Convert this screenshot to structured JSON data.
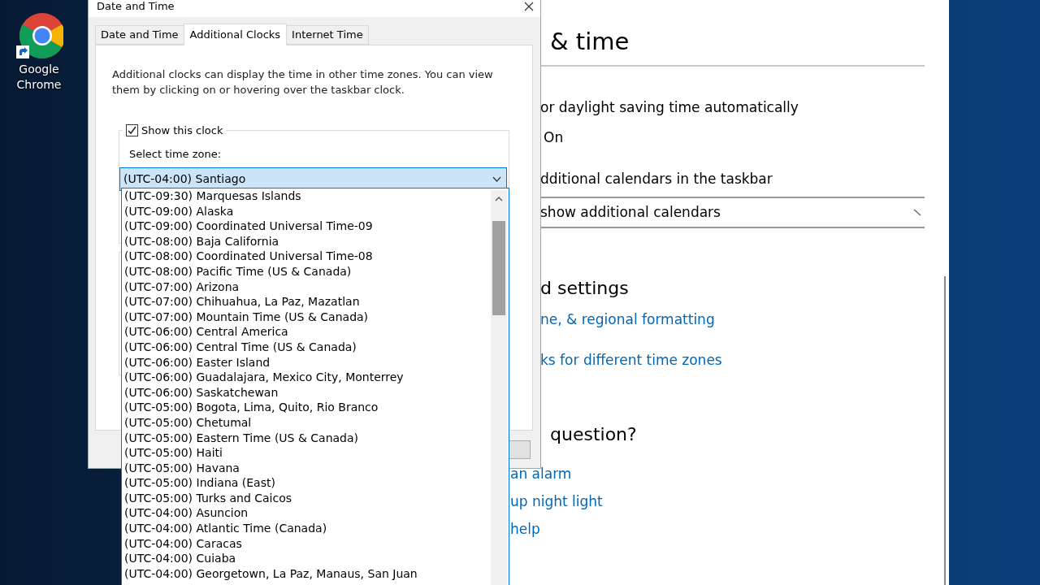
{
  "desktop": {
    "icons": [
      {
        "label": "Google Chrome"
      }
    ]
  },
  "settings": {
    "heading": "& time",
    "rows": [
      {
        "kind": "label",
        "text": "or daylight saving time automatically"
      },
      {
        "kind": "value",
        "text": "On"
      },
      {
        "kind": "label",
        "text": "dditional calendars in the taskbar"
      },
      {
        "kind": "select",
        "text": "show additional calendars"
      },
      {
        "kind": "heading",
        "text": "d settings"
      },
      {
        "kind": "link",
        "text": "ne, & regional formatting"
      },
      {
        "kind": "link",
        "text": "ks for different time zones"
      },
      {
        "kind": "heading",
        "text": "question?"
      },
      {
        "kind": "link",
        "text": "an alarm"
      },
      {
        "kind": "link",
        "text": "up night light"
      },
      {
        "kind": "link",
        "text": "help"
      }
    ]
  },
  "dialog": {
    "title": "Date and Time",
    "tabs": [
      {
        "label": "Date and Time",
        "selected": false
      },
      {
        "label": "Additional Clocks",
        "selected": true
      },
      {
        "label": "Internet Time",
        "selected": false
      }
    ],
    "description": "Additional clocks can display the time in other time zones. You can view them by clicking on or hovering over the taskbar clock.",
    "show_clock": {
      "label": "Show this clock",
      "checked": true
    },
    "time_zone": {
      "label": "Select time zone:",
      "value": "(UTC-04:00) Santiago",
      "options": [
        {
          "label": "(UTC-09:30) Marquesas Islands",
          "selected": false
        },
        {
          "label": "(UTC-09:00) Alaska",
          "selected": false
        },
        {
          "label": "(UTC-09:00) Coordinated Universal Time-09",
          "selected": false
        },
        {
          "label": "(UTC-08:00) Baja California",
          "selected": false
        },
        {
          "label": "(UTC-08:00) Coordinated Universal Time-08",
          "selected": false
        },
        {
          "label": "(UTC-08:00) Pacific Time (US & Canada)",
          "selected": false
        },
        {
          "label": "(UTC-07:00) Arizona",
          "selected": false
        },
        {
          "label": "(UTC-07:00) Chihuahua, La Paz, Mazatlan",
          "selected": false
        },
        {
          "label": "(UTC-07:00) Mountain Time (US & Canada)",
          "selected": false
        },
        {
          "label": "(UTC-06:00) Central America",
          "selected": false
        },
        {
          "label": "(UTC-06:00) Central Time (US & Canada)",
          "selected": false
        },
        {
          "label": "(UTC-06:00) Easter Island",
          "selected": false
        },
        {
          "label": "(UTC-06:00) Guadalajara, Mexico City, Monterrey",
          "selected": false
        },
        {
          "label": "(UTC-06:00) Saskatchewan",
          "selected": false
        },
        {
          "label": "(UTC-05:00) Bogota, Lima, Quito, Rio Branco",
          "selected": false
        },
        {
          "label": "(UTC-05:00) Chetumal",
          "selected": false
        },
        {
          "label": "(UTC-05:00) Eastern Time (US & Canada)",
          "selected": false
        },
        {
          "label": "(UTC-05:00) Haiti",
          "selected": false
        },
        {
          "label": "(UTC-05:00) Havana",
          "selected": false
        },
        {
          "label": "(UTC-05:00) Indiana (East)",
          "selected": false
        },
        {
          "label": "(UTC-05:00) Turks and Caicos",
          "selected": false
        },
        {
          "label": "(UTC-04:00) Asuncion",
          "selected": false
        },
        {
          "label": "(UTC-04:00) Atlantic Time (Canada)",
          "selected": false
        },
        {
          "label": "(UTC-04:00) Caracas",
          "selected": false
        },
        {
          "label": "(UTC-04:00) Cuiaba",
          "selected": false
        },
        {
          "label": "(UTC-04:00) Georgetown, La Paz, Manaus, San Juan",
          "selected": false
        }
      ]
    }
  }
}
